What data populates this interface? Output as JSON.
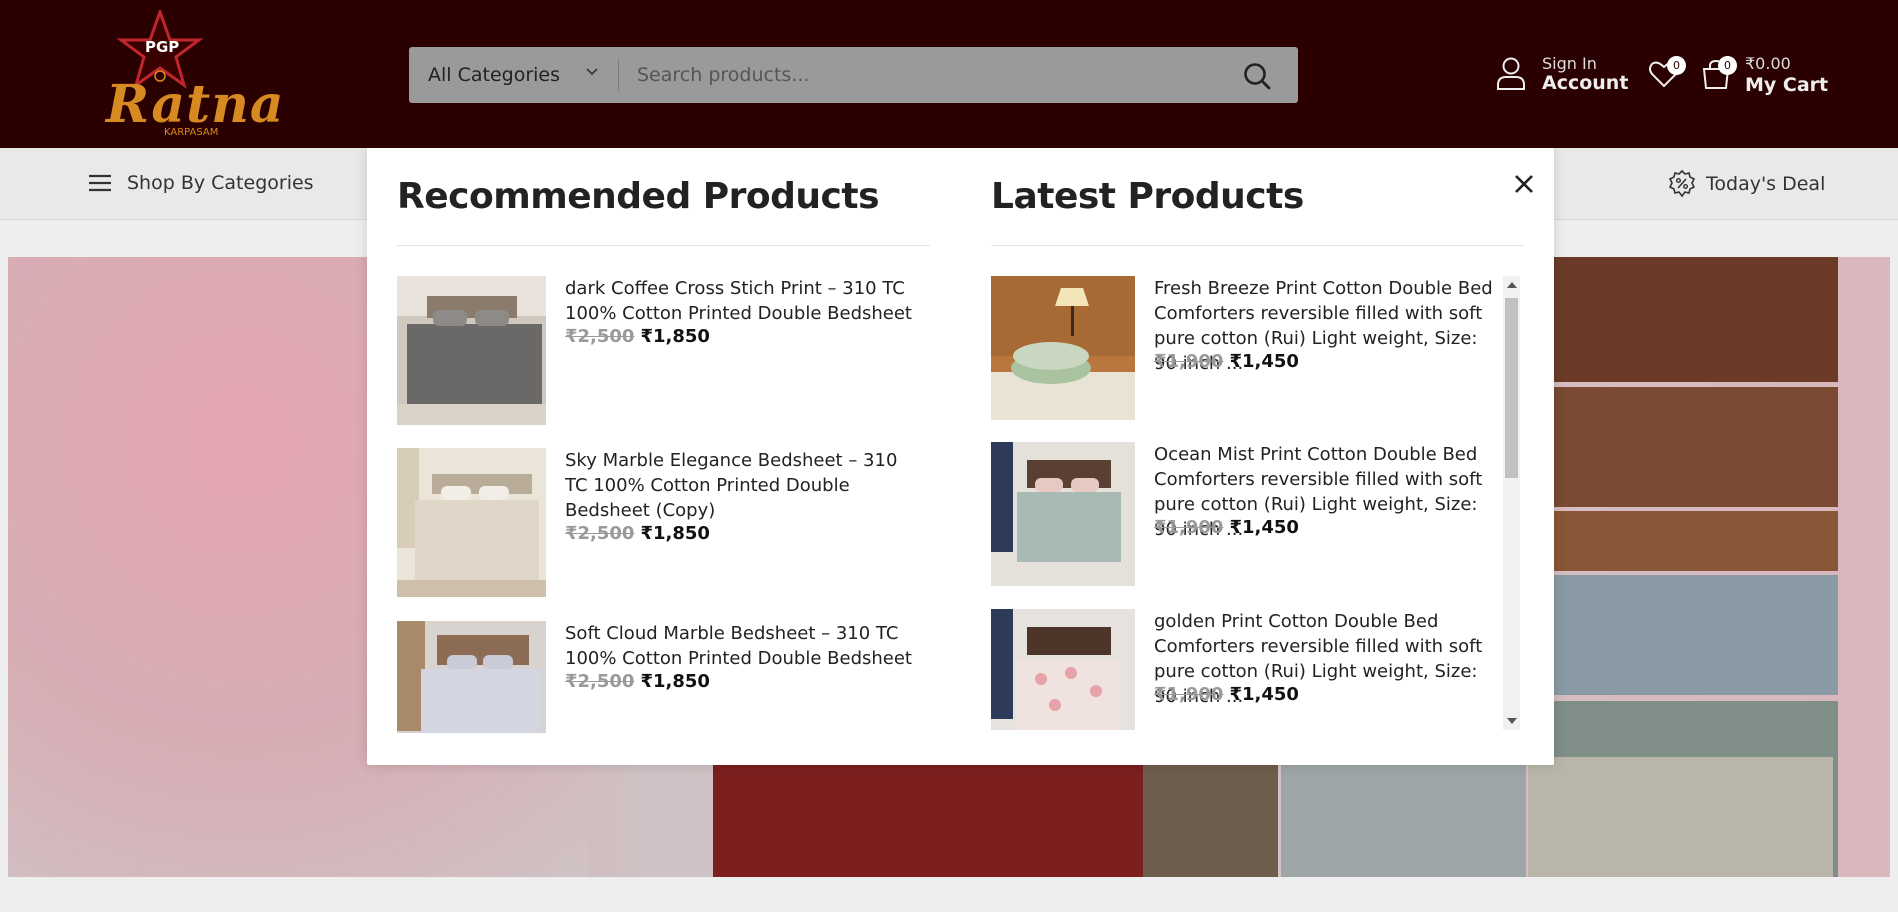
{
  "header": {
    "logo": {
      "top": "PGP",
      "main": "Ratna",
      "sub": "KARPASAM"
    },
    "search": {
      "category": "All Categories",
      "placeholder": "Search products..."
    },
    "account": {
      "small": "Sign In",
      "big": "Account"
    },
    "wishlist_count": "0",
    "cart": {
      "count": "0",
      "price": "₹0.00",
      "label": "My Cart"
    }
  },
  "nav": {
    "shop_by_categories": "Shop By Categories",
    "todays_deal": "Today's Deal"
  },
  "modal": {
    "recommended_title": "Recommended Products",
    "latest_title": "Latest Products",
    "recommended": [
      {
        "name": "dark Coffee Cross Stich Print – 310 TC 100% Cotton Printed Double Bedsheet",
        "old_price": "₹2,500",
        "price": "₹1,850"
      },
      {
        "name": "Sky Marble Elegance Bedsheet – 310 TC 100% Cotton Printed Double Bedsheet (Copy)",
        "old_price": "₹2,500",
        "price": "₹1,850"
      },
      {
        "name": "Soft Cloud Marble Bedsheet – 310 TC 100% Cotton Printed Double Bedsheet",
        "old_price": "₹2,500",
        "price": "₹1,850"
      }
    ],
    "latest": [
      {
        "name": "Fresh Breeze Print Cotton Double Bed Comforters reversible filled with soft pure cotton (Rui) Light weight, Size: 90 inch ...",
        "old_price": "₹1,900",
        "price": "₹1,450"
      },
      {
        "name": "Ocean Mist Print Cotton Double Bed Comforters reversible filled with soft pure cotton (Rui) Light weight, Size: 90 inch ...",
        "old_price": "₹1,900",
        "price": "₹1,450"
      },
      {
        "name": "golden Print Cotton Double Bed Comforters reversible filled with soft pure cotton (Rui) Light weight, Size: 90 inch ...",
        "old_price": "₹1,900",
        "price": "₹1,450"
      }
    ]
  },
  "colors": {
    "header_bg": "#2b0000",
    "brand_gold": "#d68a21",
    "logo_red": "#c0262e"
  }
}
